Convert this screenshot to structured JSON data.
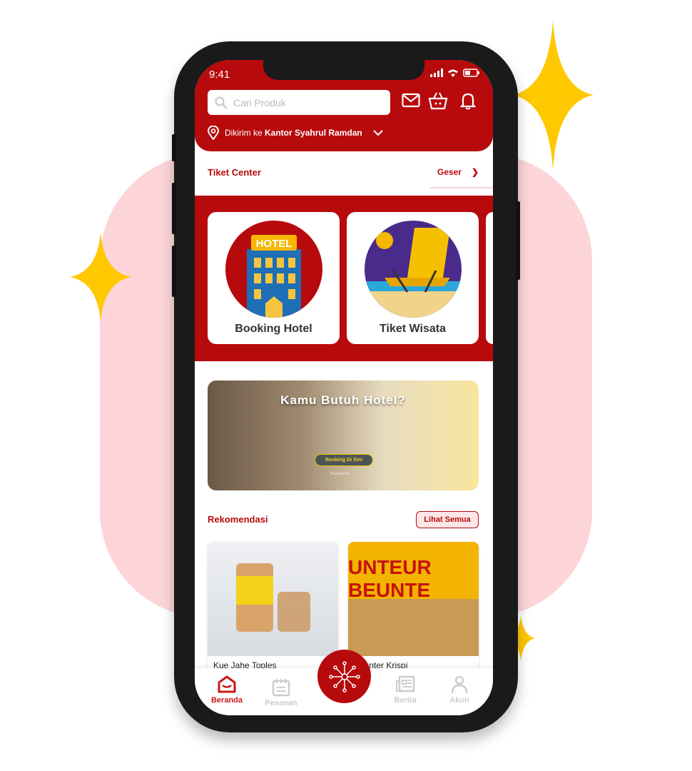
{
  "status_bar": {
    "time": "9:41"
  },
  "header": {
    "search_placeholder": "Cari Produk",
    "delivery_prefix": "Dikirim ke",
    "delivery_address": "Kantor Syahrul Ramdan"
  },
  "ticket_center": {
    "title": "Tiket Center",
    "scroll_label": "Geser",
    "items": [
      {
        "label": "Booking Hotel"
      },
      {
        "label": "Tiket Wisata"
      }
    ]
  },
  "banner": {
    "headline": "Kamu Butuh Hotel?",
    "button": "Booking Di Sini",
    "powered_by": "Powered by"
  },
  "recommendations": {
    "title": "Rekomendasi",
    "see_all": "Lihat Semua",
    "products": [
      {
        "name": "Kue Jahe Toples"
      },
      {
        "name": "Beunter Krispi"
      }
    ]
  },
  "bottom_nav": {
    "items": [
      {
        "label": "Beranda",
        "active": true
      },
      {
        "label": "Pesanan"
      },
      {
        "label": "Berita"
      },
      {
        "label": "Akun"
      }
    ]
  },
  "colors": {
    "primary": "#b70a0c",
    "background_blob": "#fdd5d8",
    "sparkle": "#ffc800"
  }
}
